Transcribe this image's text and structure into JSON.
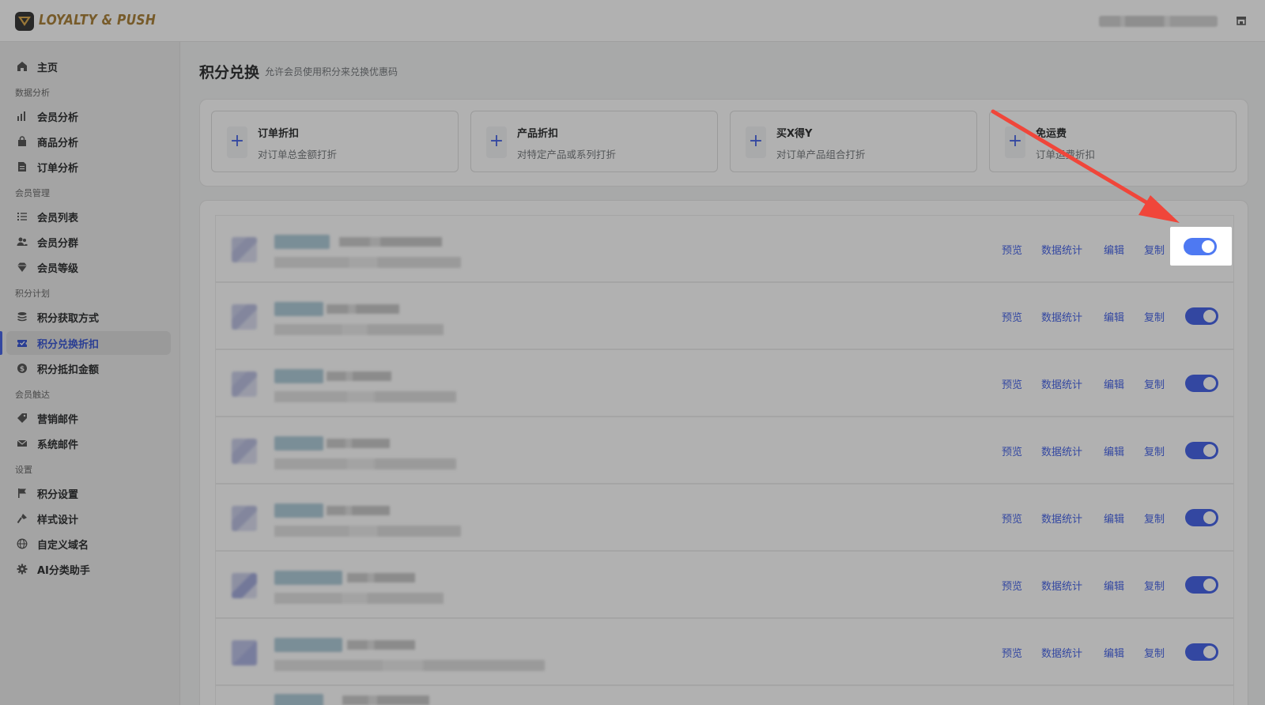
{
  "app": {
    "logo_text": "LOYALTY & PUSH"
  },
  "sidebar": {
    "home": "主页",
    "section_analytics": "数据分析",
    "member_analytics": "会员分析",
    "product_analytics": "商品分析",
    "order_analytics": "订单分析",
    "section_members": "会员管理",
    "member_list": "会员列表",
    "member_segments": "会员分群",
    "member_tiers": "会员等级",
    "section_points": "积分计划",
    "earn_points": "积分获取方式",
    "redeem_discount": "积分兑换折扣",
    "points_deduction": "积分抵扣金额",
    "section_reach": "会员触达",
    "marketing_email": "营销邮件",
    "system_email": "系统邮件",
    "section_settings": "设置",
    "points_settings": "积分设置",
    "style_design": "样式设计",
    "custom_domain": "自定义域名",
    "ai_assistant": "AI分类助手"
  },
  "page": {
    "title": "积分兑换",
    "subtitle": "允许会员使用积分来兑换优惠码"
  },
  "create_cards": [
    {
      "title": "订单折扣",
      "desc": "对订单总金额打折"
    },
    {
      "title": "产品折扣",
      "desc": "对特定产品或系列打折"
    },
    {
      "title": "买X得Y",
      "desc": "对订单产品组合打折"
    },
    {
      "title": "免运费",
      "desc": "订单运费折扣"
    }
  ],
  "row_actions": {
    "preview": "预览",
    "stats": "数据统计",
    "edit": "编辑",
    "copy": "复制"
  },
  "rows": [
    {
      "enabled": true,
      "highlighted": true
    },
    {
      "enabled": true
    },
    {
      "enabled": true
    },
    {
      "enabled": true
    },
    {
      "enabled": true
    },
    {
      "enabled": true
    },
    {
      "enabled": true
    }
  ],
  "colors": {
    "accent": "#3a5ae6",
    "brand_gold": "#a4792c",
    "annotation_arrow": "#f0463a"
  }
}
